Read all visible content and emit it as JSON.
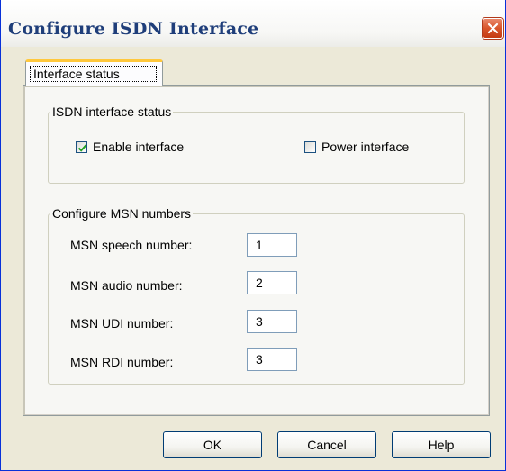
{
  "window": {
    "title": "Configure ISDN Interface"
  },
  "tabs": [
    {
      "label": "Interface status",
      "selected": true
    }
  ],
  "isdn_status": {
    "legend": "ISDN interface status",
    "enable_interface": {
      "label": "Enable interface",
      "checked": true
    },
    "power_interface": {
      "label": "Power interface",
      "checked": false
    }
  },
  "msn": {
    "legend": "Configure MSN numbers",
    "fields": [
      {
        "label": "MSN speech number:",
        "value": "1"
      },
      {
        "label": "MSN audio number:",
        "value": "2"
      },
      {
        "label": "MSN UDI number:",
        "value": "3"
      },
      {
        "label": "MSN RDI number:",
        "value": "3"
      }
    ]
  },
  "buttons": {
    "ok": "OK",
    "cancel": "Cancel",
    "help": "Help"
  },
  "colors": {
    "title_text": "#1f3e7a",
    "close_button": "#d8542a",
    "tab_highlight": "#ffc83c",
    "dialog_background": "#ece9d8"
  },
  "icons": {
    "close": "close-icon",
    "check": "checkmark-icon"
  }
}
